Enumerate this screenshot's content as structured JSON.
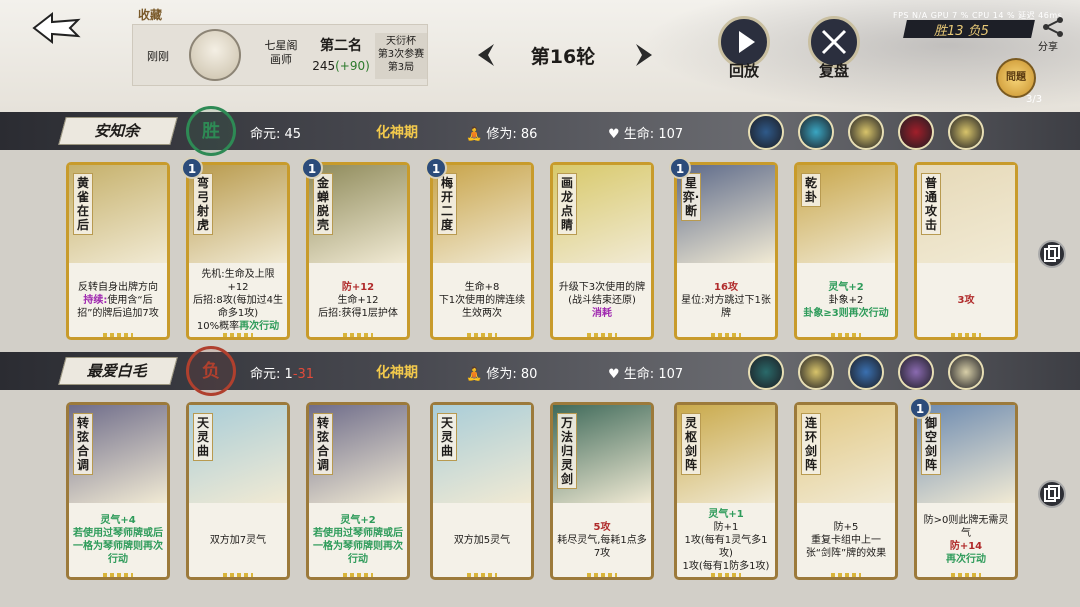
{
  "header": {
    "favorite_label": "收藏",
    "player": {
      "name": "刚刚",
      "title_line1": "七星阁",
      "title_line2": "画师",
      "rank": "第二名",
      "score": "245",
      "score_delta": "(+90)",
      "cup_line1": "天衍杯",
      "cup_line2": "第3次参赛",
      "cup_line3": "第3局"
    },
    "round_label": "第16轮",
    "replay_label": "回放",
    "review_label": "复盘",
    "stats": "FPS N/A  GPU 7 %  CPU 14 %  延迟 46ms",
    "wins_losses": "胜13  负5",
    "share_label": "分享",
    "lantern_label": "問題",
    "lantern_count": "3/3"
  },
  "players": [
    {
      "name": "安知余",
      "result": "胜",
      "life_label": "命元:",
      "life": "45",
      "life_loss": "",
      "realm": "化神期",
      "cultivation_label": "修为:",
      "cultivation": "86",
      "hp_label": "生命:",
      "hp": "107",
      "cards": [
        {
          "name": "黄雀在后",
          "level": "",
          "lines": [
            {
              "t": "反转自身出牌方向"
            },
            {
              "t": "持续:",
              "c": "hlp",
              "rest": "使用含“后招”的牌后追加7攻"
            }
          ],
          "bg": "#c5b06a"
        },
        {
          "name": "弯弓射虎",
          "level": "1",
          "lines": [
            {
              "t": "先机:生命及上限+12"
            },
            {
              "t": "后招:",
              "rest": "8攻(每加过4生命多1攻)"
            },
            {
              "t": "10%概率",
              "rest": "再次行动",
              "rc": "hl"
            }
          ],
          "bg": "#b89a4c"
        },
        {
          "name": "金蝉脱壳",
          "level": "1",
          "lines": [
            {
              "t": "防+12",
              "c": "hlr"
            },
            {
              "t": "生命+12"
            },
            {
              "t": "后招:获得1层护体"
            }
          ],
          "bg": "#8e8a5a"
        },
        {
          "name": "梅开二度",
          "level": "1",
          "lines": [
            {
              "t": "生命+8"
            },
            {
              "t": "下1次使用的牌连续生效两次"
            }
          ],
          "bg": "#c8a44a"
        },
        {
          "name": "画龙点睛",
          "level": "",
          "lines": [
            {
              "t": "升级下3次使用的牌(战斗结束还原)"
            },
            {
              "t": "消耗",
              "c": "hlp"
            }
          ],
          "bg": "#d8c96a"
        },
        {
          "name": "星弈·断",
          "level": "1",
          "lines": [
            {
              "t": "16攻",
              "c": "hlr"
            },
            {
              "t": "星位:对方跳过下1张牌"
            }
          ],
          "bg": "#5d6a8a"
        },
        {
          "name": "乾卦",
          "level": "",
          "lines": [
            {
              "t": "灵气+2",
              "c": "hl"
            },
            {
              "t": "卦象+2"
            },
            {
              "t": "卦象≥3则再次行动",
              "c": "hl"
            }
          ],
          "bg": "#c8a64a"
        },
        {
          "name": "普通攻击",
          "level": "",
          "lines": [
            {
              "t": "3攻",
              "c": "hlr"
            }
          ],
          "bg": "#e6d9b8"
        }
      ]
    },
    {
      "name": "最爱白毛",
      "result": "负",
      "life_label": "命元:",
      "life": "1",
      "life_loss": "-31",
      "realm": "化神期",
      "cultivation_label": "修为:",
      "cultivation": "80",
      "hp_label": "生命:",
      "hp": "107",
      "cards": [
        {
          "name": "转弦合调",
          "level": "",
          "lines": [
            {
              "t": "灵气+4",
              "c": "hl"
            },
            {
              "t": "若使用过琴师牌或后一格为琴师牌则再次行动",
              "c": "hl"
            }
          ],
          "bg": "#6e6c8a"
        },
        {
          "name": "天灵曲",
          "level": "",
          "lines": [
            {
              "t": "双方加7灵气"
            }
          ],
          "bg": "#a9cdd8"
        },
        {
          "name": "转弦合调",
          "level": "",
          "lines": [
            {
              "t": "灵气+2",
              "c": "hl"
            },
            {
              "t": "若使用过琴师牌或后一格为琴师牌则再次行动",
              "c": "hl"
            }
          ],
          "bg": "#6e6c8a"
        },
        {
          "name": "天灵曲",
          "level": "",
          "lines": [
            {
              "t": "双方加5灵气"
            }
          ],
          "bg": "#a9cdd8"
        },
        {
          "name": "万法归灵剑",
          "level": "",
          "lines": [
            {
              "t": "5攻",
              "c": "hlr"
            },
            {
              "t": "耗尽灵气,每耗1点多7攻"
            }
          ],
          "bg": "#3f6a5a"
        },
        {
          "name": "灵枢剑阵",
          "level": "",
          "lines": [
            {
              "t": "灵气+1",
              "c": "hl"
            },
            {
              "t": "防+1"
            },
            {
              "t": "1攻(每有1灵气多1攻)"
            },
            {
              "t": "1攻(每有1防多1攻)"
            }
          ],
          "bg": "#c9a94a"
        },
        {
          "name": "连环剑阵",
          "level": "",
          "lines": [
            {
              "t": "防+5"
            },
            {
              "t": "重复卡组中上一张“剑阵”牌的效果"
            }
          ],
          "bg": "#e2c883"
        },
        {
          "name": "御空剑阵",
          "level": "1",
          "lines": [
            {
              "t": "防>0则此牌无需灵气"
            },
            {
              "t": "防+14",
              "c": "hlr"
            },
            {
              "t": "再次行动",
              "c": "hl"
            }
          ],
          "bg": "#6c8ab0"
        }
      ]
    }
  ],
  "icons": {
    "back": "back-arrow-icon",
    "share": "share-icon",
    "replay": "play-icon",
    "review": "crossed-swords-icon"
  }
}
